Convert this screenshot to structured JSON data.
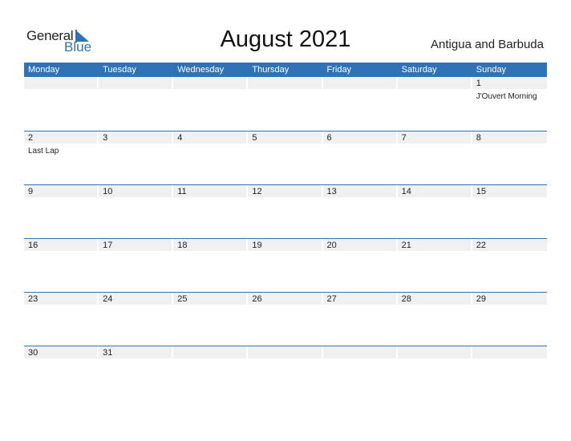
{
  "logo": {
    "line1": "General",
    "line2": "Blue"
  },
  "header": {
    "title": "August 2021",
    "country": "Antigua and Barbuda"
  },
  "colors": {
    "accent": "#2f72b5",
    "band": "#f0f0f0"
  },
  "weekdays": [
    "Monday",
    "Tuesday",
    "Wednesday",
    "Thursday",
    "Friday",
    "Saturday",
    "Sunday"
  ],
  "weeks": [
    [
      {
        "d": ""
      },
      {
        "d": ""
      },
      {
        "d": ""
      },
      {
        "d": ""
      },
      {
        "d": ""
      },
      {
        "d": ""
      },
      {
        "d": "1",
        "h": "J'Ouvert Morning"
      }
    ],
    [
      {
        "d": "2",
        "h": "Last Lap"
      },
      {
        "d": "3"
      },
      {
        "d": "4"
      },
      {
        "d": "5"
      },
      {
        "d": "6"
      },
      {
        "d": "7"
      },
      {
        "d": "8"
      }
    ],
    [
      {
        "d": "9"
      },
      {
        "d": "10"
      },
      {
        "d": "11"
      },
      {
        "d": "12"
      },
      {
        "d": "13"
      },
      {
        "d": "14"
      },
      {
        "d": "15"
      }
    ],
    [
      {
        "d": "16"
      },
      {
        "d": "17"
      },
      {
        "d": "18"
      },
      {
        "d": "19"
      },
      {
        "d": "20"
      },
      {
        "d": "21"
      },
      {
        "d": "22"
      }
    ],
    [
      {
        "d": "23"
      },
      {
        "d": "24"
      },
      {
        "d": "25"
      },
      {
        "d": "26"
      },
      {
        "d": "27"
      },
      {
        "d": "28"
      },
      {
        "d": "29"
      }
    ],
    [
      {
        "d": "30"
      },
      {
        "d": "31"
      },
      {
        "d": ""
      },
      {
        "d": ""
      },
      {
        "d": ""
      },
      {
        "d": ""
      },
      {
        "d": ""
      }
    ]
  ]
}
